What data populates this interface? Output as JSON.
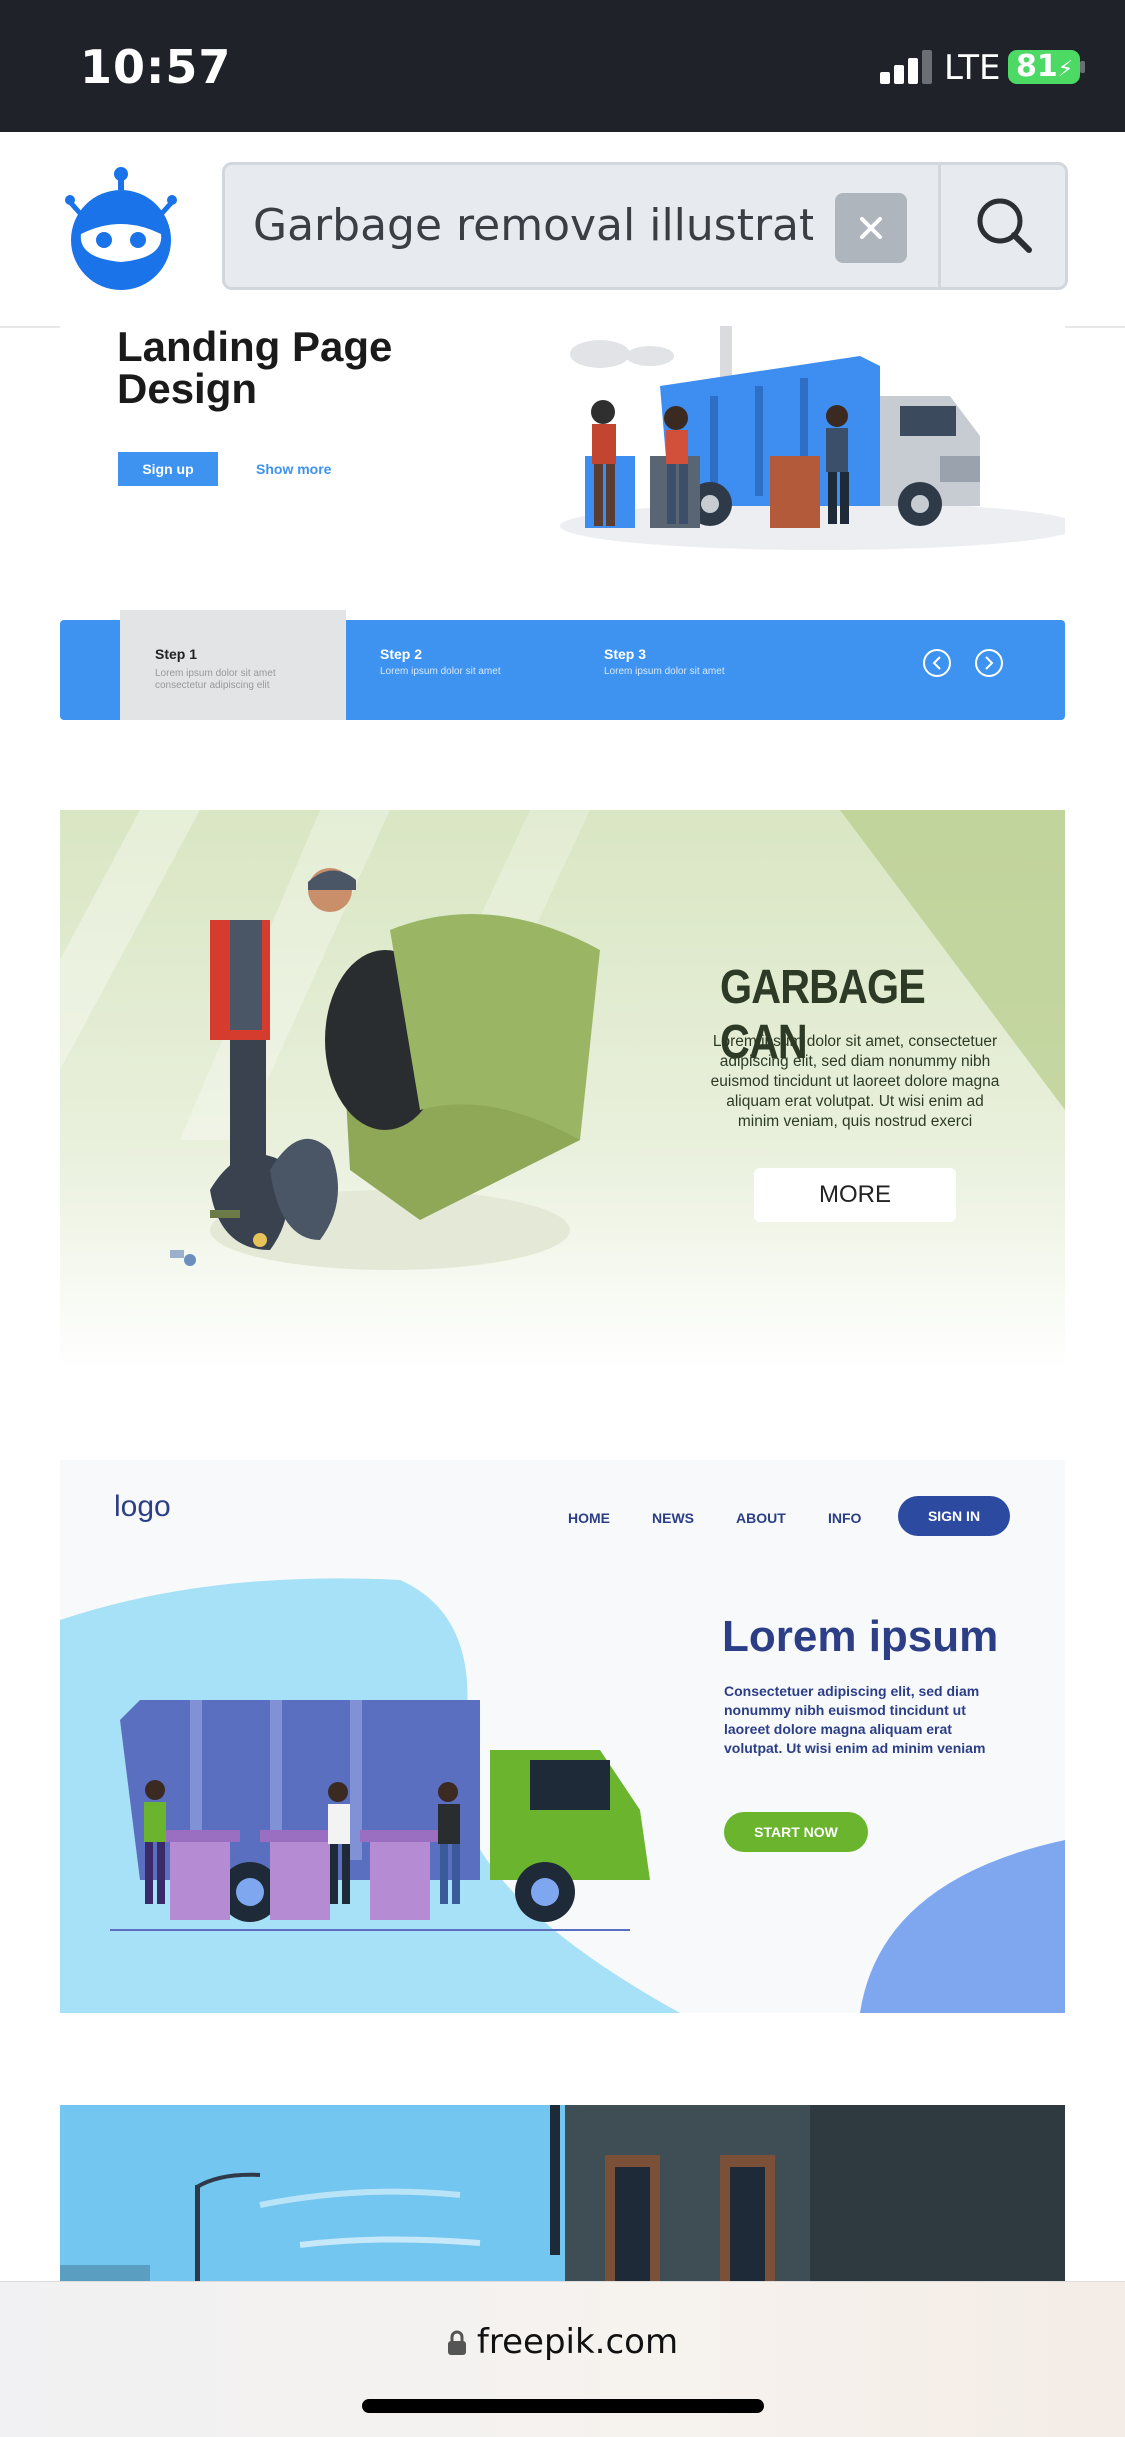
{
  "status_bar": {
    "time": "10:57",
    "network": "LTE",
    "battery": "81"
  },
  "search": {
    "query": "Garbage removal illustratio",
    "icons": [
      "robot-logo-icon",
      "clear-icon",
      "search-icon"
    ]
  },
  "results": [
    {
      "title": "Landing Page Design",
      "primary_button": "Sign up",
      "link": "Show more",
      "steps": [
        {
          "label": "Step 1",
          "text": "Lorem ipsum dolor sit amet consectetur adipiscing elit"
        },
        {
          "label": "Step 2",
          "text": "Lorem ipsum dolor sit amet"
        },
        {
          "label": "Step 3",
          "text": "Lorem ipsum dolor sit amet"
        }
      ]
    },
    {
      "title": "GARBAGE CAN",
      "body": "Lorem ipsum dolor sit amet, consectetuer adipiscing elit, sed diam nonummy nibh euismod tincidunt ut laoreet dolore magna aliquam erat volutpat. Ut wisi enim ad minim veniam, quis nostrud exerci",
      "button": "MORE"
    },
    {
      "logo": "logo",
      "nav": [
        "HOME",
        "NEWS",
        "ABOUT",
        "INFO"
      ],
      "sign_in": "SIGN IN",
      "title": "Lorem ipsum",
      "body": "Consectetuer adipiscing elit, sed diam nonummy nibh euismod tincidunt ut laoreet dolore magna aliquam erat volutpat. Ut wisi enim ad minim veniam",
      "button": "START NOW"
    }
  ],
  "browser": {
    "url": "freepik.com"
  },
  "colors": {
    "accent": "#3d93ef",
    "brand_green": "#6ab42e",
    "navy": "#2c3e86"
  }
}
